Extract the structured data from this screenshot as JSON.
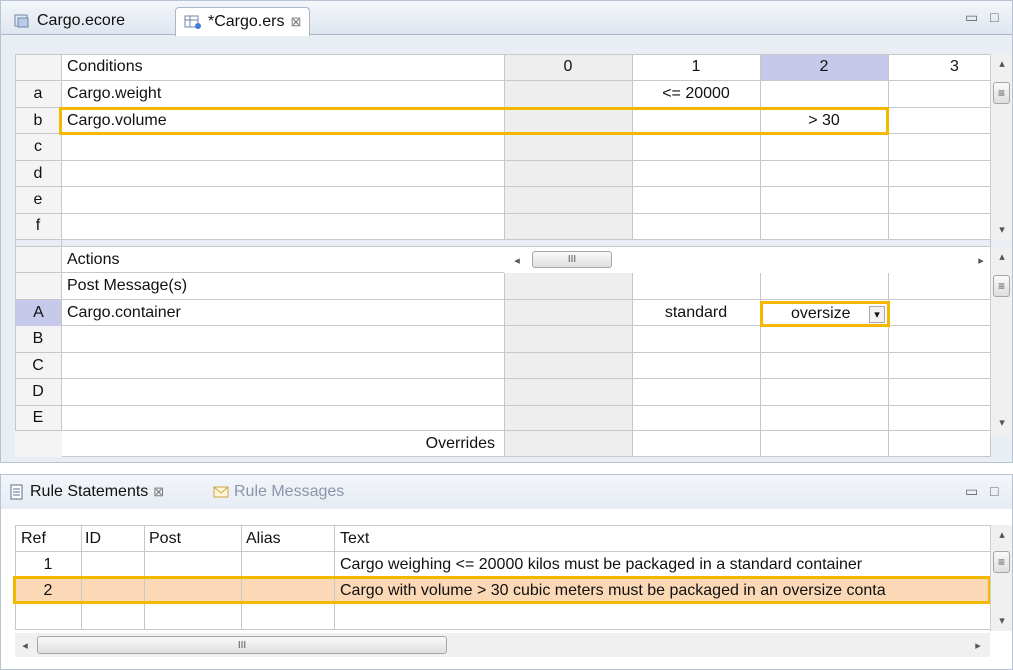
{
  "editor": {
    "tabs": [
      {
        "label": "Cargo.ecore",
        "active": false
      },
      {
        "label": "*Cargo.ers",
        "active": true,
        "close": "⊠"
      }
    ],
    "window_controls": {
      "minimize": "▭",
      "maximize": "□"
    }
  },
  "conditions": {
    "header": "Conditions",
    "columns": [
      "0",
      "1",
      "2",
      "3"
    ],
    "selected_column": "2",
    "rows": [
      {
        "letter": "a",
        "name": "Cargo.weight",
        "c0": "",
        "c1": "<= 20000",
        "c2": "",
        "c3": ""
      },
      {
        "letter": "b",
        "name": "Cargo.volume",
        "c0": "",
        "c1": "",
        "c2": "> 30",
        "c3": ""
      },
      {
        "letter": "c",
        "name": ""
      },
      {
        "letter": "d",
        "name": ""
      },
      {
        "letter": "e",
        "name": ""
      },
      {
        "letter": "f",
        "name": ""
      }
    ]
  },
  "actions": {
    "header": "Actions",
    "post_message_label": "Post Message(s)",
    "rows": [
      {
        "letter": "A",
        "name": "Cargo.container",
        "c1": "standard",
        "c2": "oversize"
      },
      {
        "letter": "B",
        "name": ""
      },
      {
        "letter": "C",
        "name": ""
      },
      {
        "letter": "D",
        "name": ""
      },
      {
        "letter": "E",
        "name": ""
      }
    ],
    "overrides_label": "Overrides",
    "dropdown_arrow": "▾"
  },
  "scroll": {
    "left": "◂",
    "right": "▸",
    "up": "▴",
    "down": "▾",
    "grip": "III",
    "vgrip": "≡"
  },
  "rule_statements": {
    "tab_label": "Rule Statements",
    "tab_close": "⊠",
    "messages_tab_label": "Rule Messages",
    "columns": [
      "Ref",
      "ID",
      "Post",
      "Alias",
      "Text"
    ],
    "rows": [
      {
        "ref": "1",
        "id": "",
        "post": "",
        "alias": "",
        "text": "Cargo weighing <= 20000 kilos must be packaged in a standard container"
      },
      {
        "ref": "2",
        "id": "",
        "post": "",
        "alias": "",
        "text": "Cargo with volume > 30 cubic meters must be packaged in an oversize conta"
      }
    ]
  },
  "colors": {
    "highlight": "#f5b800",
    "selected_column": "#c6c9ea",
    "selected_row": "#fbd9b6"
  }
}
